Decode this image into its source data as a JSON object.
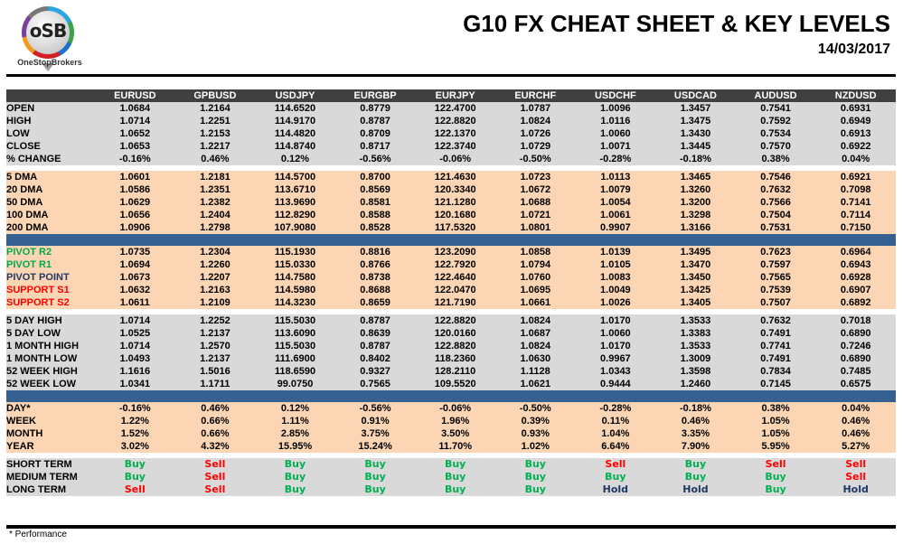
{
  "header": {
    "logo_mark": "oSB",
    "logo_name": "OneStopBrokers",
    "title": "G10 FX CHEAT SHEET & KEY LEVELS",
    "date": "14/03/2017"
  },
  "columns": [
    "EURUSD",
    "GPBUSD",
    "USDJPY",
    "EURGBP",
    "EURJPY",
    "EURCHF",
    "USDCHF",
    "USDCAD",
    "AUDUSD",
    "NZDUSD"
  ],
  "sections": [
    {
      "style": "gray",
      "rows": [
        {
          "label": "OPEN",
          "values": [
            "1.0684",
            "1.2164",
            "114.6520",
            "0.8779",
            "122.4700",
            "1.0787",
            "1.0096",
            "1.3457",
            "0.7541",
            "0.6931"
          ]
        },
        {
          "label": "HIGH",
          "values": [
            "1.0714",
            "1.2251",
            "114.9170",
            "0.8787",
            "122.8820",
            "1.0824",
            "1.0116",
            "1.3475",
            "0.7592",
            "0.6949"
          ]
        },
        {
          "label": "LOW",
          "values": [
            "1.0652",
            "1.2153",
            "114.4820",
            "0.8709",
            "122.1370",
            "1.0726",
            "1.0060",
            "1.3430",
            "0.7534",
            "0.6913"
          ]
        },
        {
          "label": "CLOSE",
          "values": [
            "1.0653",
            "1.2217",
            "114.8740",
            "0.8717",
            "122.3740",
            "1.0729",
            "1.0071",
            "1.3445",
            "0.7570",
            "0.6922"
          ]
        },
        {
          "label": "% CHANGE",
          "values": [
            "-0.16%",
            "0.46%",
            "0.12%",
            "-0.56%",
            "-0.06%",
            "-0.50%",
            "-0.28%",
            "-0.18%",
            "0.38%",
            "0.04%"
          ]
        }
      ]
    },
    {
      "style": "peach",
      "rows": [
        {
          "label": "5 DMA",
          "values": [
            "1.0601",
            "1.2181",
            "114.5700",
            "0.8700",
            "121.4630",
            "1.0723",
            "1.0113",
            "1.3465",
            "0.7546",
            "0.6921"
          ]
        },
        {
          "label": "20 DMA",
          "values": [
            "1.0586",
            "1.2351",
            "113.6710",
            "0.8569",
            "120.3340",
            "1.0672",
            "1.0079",
            "1.3260",
            "0.7632",
            "0.7098"
          ]
        },
        {
          "label": "50 DMA",
          "values": [
            "1.0629",
            "1.2382",
            "113.9690",
            "0.8581",
            "121.1280",
            "1.0688",
            "1.0054",
            "1.3200",
            "0.7566",
            "0.7141"
          ]
        },
        {
          "label": "100 DMA",
          "values": [
            "1.0656",
            "1.2404",
            "112.8290",
            "0.8588",
            "120.1680",
            "1.0721",
            "1.0061",
            "1.3298",
            "0.7504",
            "0.7114"
          ]
        },
        {
          "label": "200 DMA",
          "values": [
            "1.0906",
            "1.2798",
            "107.9080",
            "0.8528",
            "117.5320",
            "1.0801",
            "0.9907",
            "1.3166",
            "0.7531",
            "0.7150"
          ]
        }
      ]
    },
    {
      "style": "peach",
      "band_before": true,
      "rows": [
        {
          "label": "PIVOT R2",
          "color": "green",
          "values": [
            "1.0735",
            "1.2304",
            "115.1930",
            "0.8816",
            "123.2090",
            "1.0858",
            "1.0139",
            "1.3495",
            "0.7623",
            "0.6964"
          ]
        },
        {
          "label": "PIVOT R1",
          "color": "green",
          "values": [
            "1.0694",
            "1.2260",
            "115.0330",
            "0.8766",
            "122.7920",
            "1.0794",
            "1.0105",
            "1.3470",
            "0.7597",
            "0.6943"
          ]
        },
        {
          "label": "PIVOT POINT",
          "color": "navy",
          "values": [
            "1.0673",
            "1.2207",
            "114.7580",
            "0.8738",
            "122.4640",
            "1.0760",
            "1.0083",
            "1.3450",
            "0.7565",
            "0.6928"
          ]
        },
        {
          "label": "SUPPORT S1",
          "color": "red",
          "values": [
            "1.0632",
            "1.2163",
            "114.5980",
            "0.8688",
            "122.0470",
            "1.0695",
            "1.0049",
            "1.3425",
            "0.7539",
            "0.6907"
          ]
        },
        {
          "label": "SUPPORT S2",
          "color": "red",
          "values": [
            "1.0611",
            "1.2109",
            "114.3230",
            "0.8659",
            "121.7190",
            "1.0661",
            "1.0026",
            "1.3405",
            "0.7507",
            "0.6892"
          ]
        }
      ]
    },
    {
      "style": "gray",
      "rows": [
        {
          "label": "5 DAY HIGH",
          "values": [
            "1.0714",
            "1.2252",
            "115.5030",
            "0.8787",
            "122.8820",
            "1.0824",
            "1.0170",
            "1.3533",
            "0.7632",
            "0.7018"
          ]
        },
        {
          "label": "5 DAY LOW",
          "values": [
            "1.0525",
            "1.2137",
            "113.6090",
            "0.8639",
            "120.0160",
            "1.0687",
            "1.0060",
            "1.3383",
            "0.7491",
            "0.6890"
          ]
        },
        {
          "label": "1 MONTH HIGH",
          "values": [
            "1.0714",
            "1.2570",
            "115.5030",
            "0.8787",
            "122.8820",
            "1.0824",
            "1.0170",
            "1.3533",
            "0.7741",
            "0.7246"
          ]
        },
        {
          "label": "1 MONTH LOW",
          "values": [
            "1.0493",
            "1.2137",
            "111.6900",
            "0.8402",
            "118.2360",
            "1.0630",
            "0.9967",
            "1.3009",
            "0.7491",
            "0.6890"
          ]
        },
        {
          "label": "52 WEEK HIGH",
          "values": [
            "1.1616",
            "1.5016",
            "118.6590",
            "0.9327",
            "128.2110",
            "1.1128",
            "1.0343",
            "1.3598",
            "0.7834",
            "0.7485"
          ]
        },
        {
          "label": "52 WEEK LOW",
          "values": [
            "1.0341",
            "1.1711",
            "99.0750",
            "0.7565",
            "109.5520",
            "1.0621",
            "0.9444",
            "1.2460",
            "0.7145",
            "0.6575"
          ]
        }
      ]
    },
    {
      "style": "peach",
      "band_before": true,
      "rows": [
        {
          "label": "DAY*",
          "values": [
            "-0.16%",
            "0.46%",
            "0.12%",
            "-0.56%",
            "-0.06%",
            "-0.50%",
            "-0.28%",
            "-0.18%",
            "0.38%",
            "0.04%"
          ]
        },
        {
          "label": "WEEK",
          "values": [
            "1.22%",
            "0.66%",
            "1.11%",
            "0.91%",
            "1.96%",
            "0.39%",
            "0.11%",
            "0.46%",
            "1.05%",
            "0.46%"
          ]
        },
        {
          "label": "MONTH",
          "values": [
            "1.52%",
            "0.66%",
            "2.85%",
            "3.75%",
            "3.50%",
            "0.93%",
            "1.04%",
            "3.35%",
            "1.05%",
            "0.46%"
          ]
        },
        {
          "label": "YEAR",
          "values": [
            "3.02%",
            "4.32%",
            "15.95%",
            "15.24%",
            "11.70%",
            "1.02%",
            "6.64%",
            "7.90%",
            "5.95%",
            "5.27%"
          ]
        }
      ]
    },
    {
      "style": "gray",
      "signals": true,
      "rows": [
        {
          "label": "SHORT TERM",
          "values": [
            "Buy",
            "Sell",
            "Buy",
            "Buy",
            "Buy",
            "Buy",
            "Sell",
            "Buy",
            "Sell",
            "Sell"
          ]
        },
        {
          "label": "MEDIUM TERM",
          "values": [
            "Buy",
            "Sell",
            "Buy",
            "Buy",
            "Buy",
            "Buy",
            "Buy",
            "Buy",
            "Buy",
            "Sell"
          ]
        },
        {
          "label": "LONG TERM",
          "values": [
            "Sell",
            "Sell",
            "Buy",
            "Buy",
            "Buy",
            "Buy",
            "Hold",
            "Hold",
            "Buy",
            "Hold"
          ]
        }
      ]
    }
  ],
  "footnote": "* Performance",
  "colors": {
    "header_bg": "#404040",
    "gray_bg": "#d9d9d9",
    "peach_bg": "#fcd5b4",
    "band_bg": "#376092",
    "buy": "#00b050",
    "sell": "#ff0000",
    "hold": "#1f3864",
    "pivot_resistance": "#00a94f",
    "pivot_point": "#1f3864",
    "support": "#ff0000"
  }
}
